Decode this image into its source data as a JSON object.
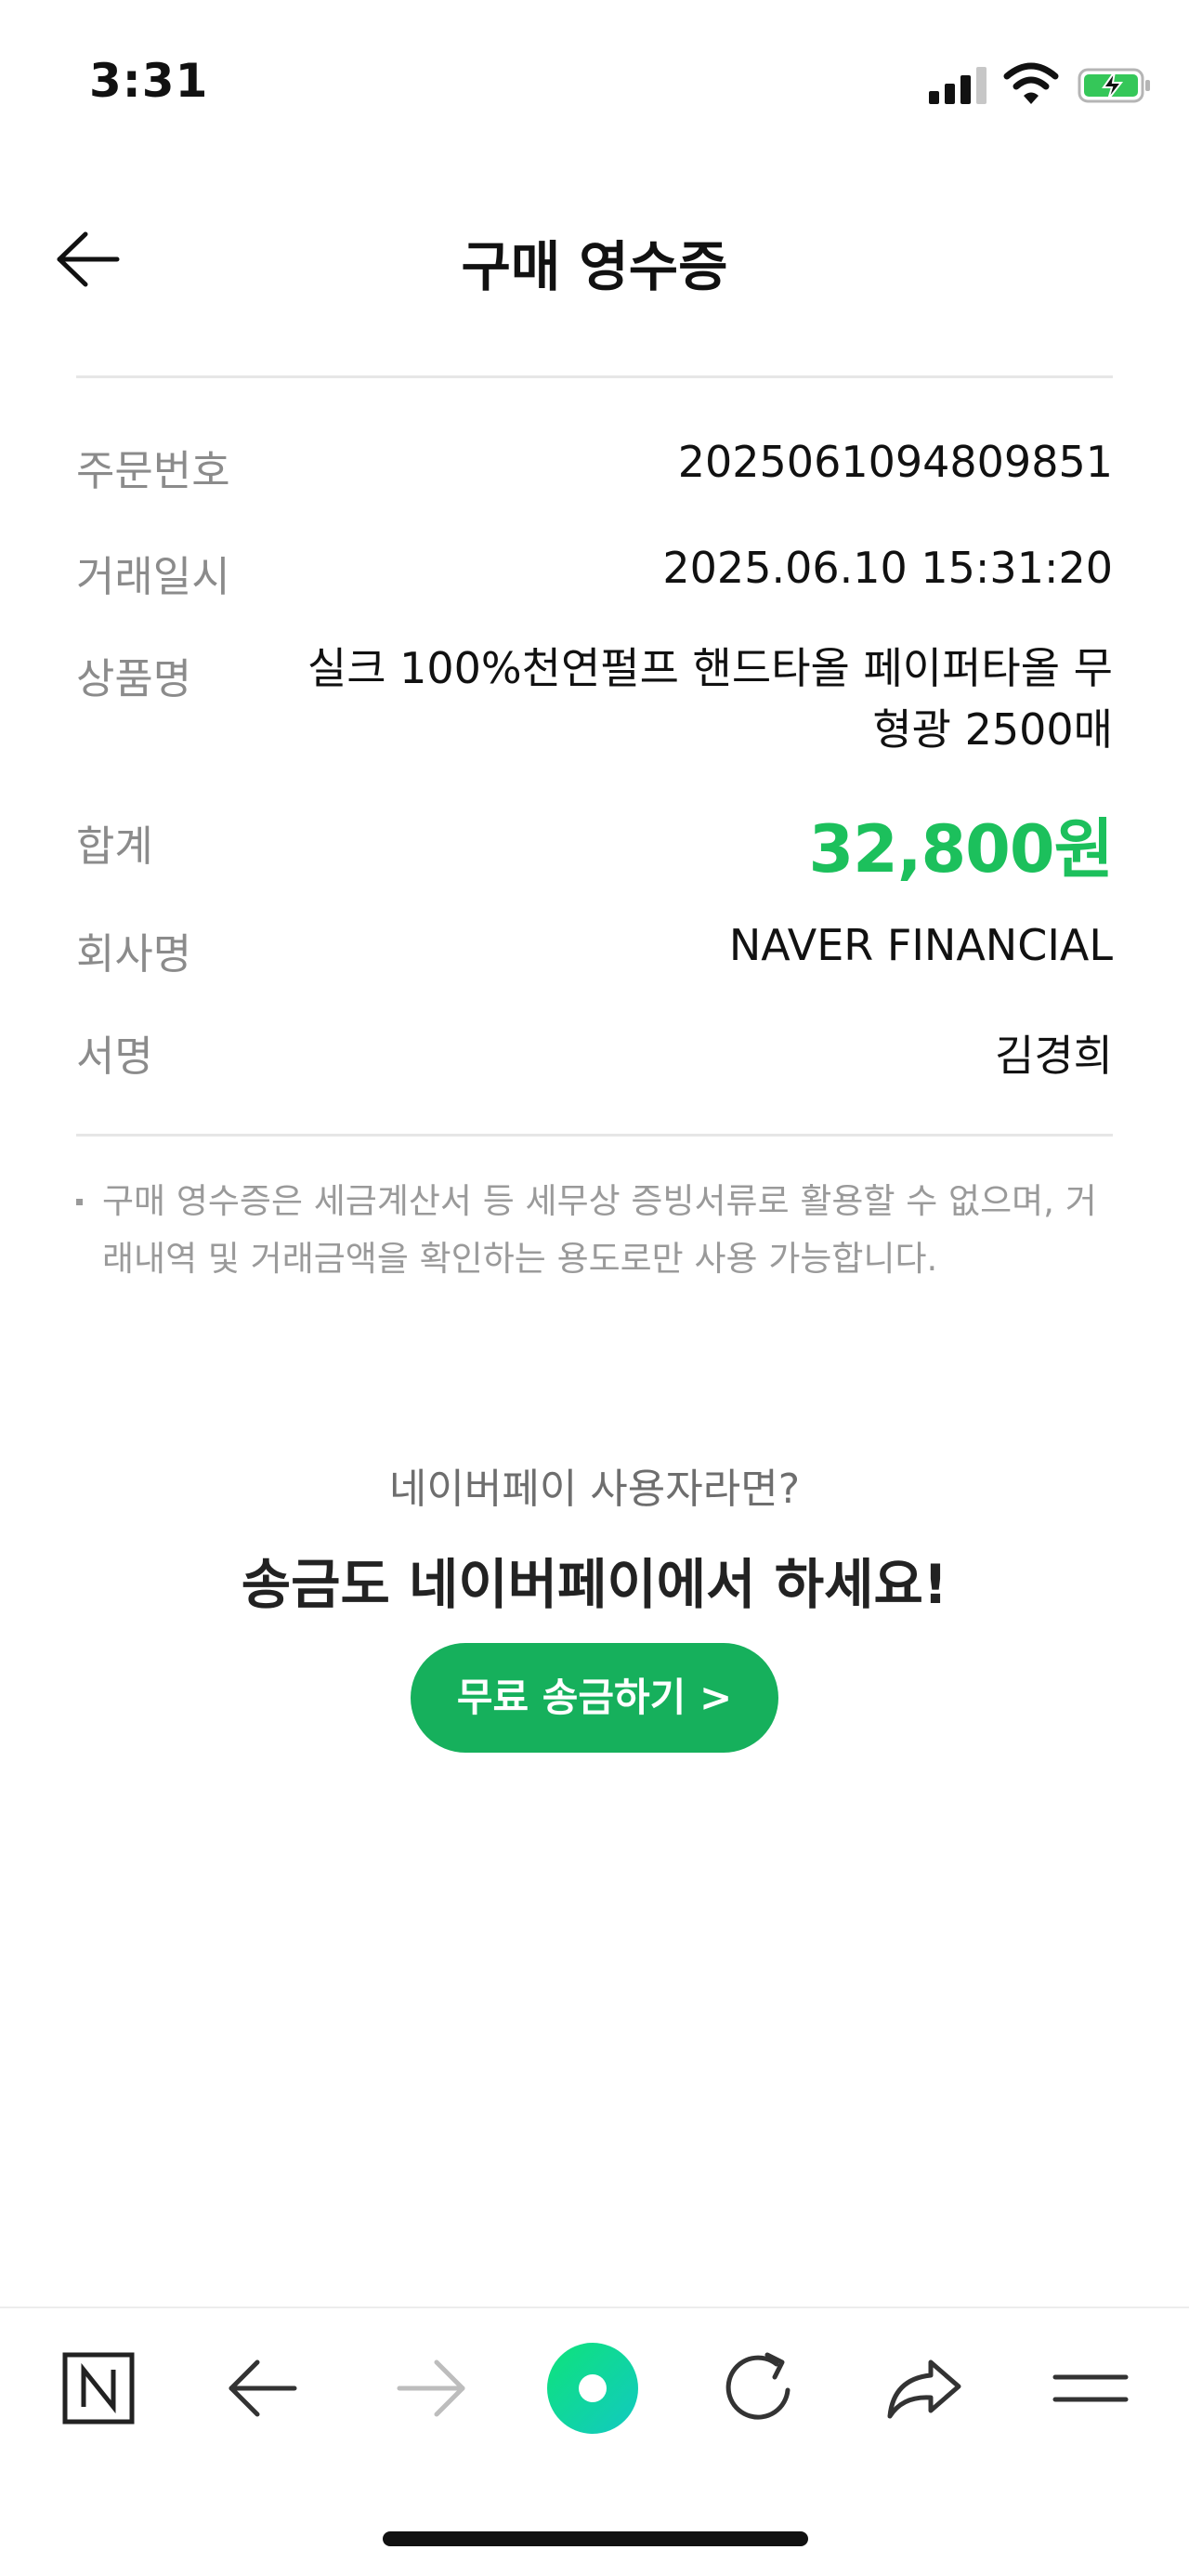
{
  "status_bar": {
    "time": "3:31"
  },
  "header": {
    "title": "구매 영수증"
  },
  "receipt": {
    "rows": [
      {
        "label": "주문번호",
        "value": "2025061094809851"
      },
      {
        "label": "거래일시",
        "value": "2025.06.10 15:31:20"
      },
      {
        "label": "상품명",
        "value": "실크 100%천연펄프 핸드타올 페이퍼타올 무형광 2500매"
      },
      {
        "label": "합계",
        "value": "32,800원"
      },
      {
        "label": "회사명",
        "value": "NAVER FINANCIAL"
      },
      {
        "label": "서명",
        "value": "김경희"
      }
    ],
    "notice": "구매 영수증은 세금계산서 등 세무상 증빙서류로 활용할 수 없으며, 거래내역 및 거래금액을 확인하는 용도로만 사용 가능합니다."
  },
  "promo": {
    "subtitle": "네이버페이 사용자라면?",
    "headline": "송금도 네이버페이에서 하세요!",
    "button_label": "무료 송금하기 >"
  },
  "colors": {
    "total_amount": "#1cc05c",
    "promo_button": "#16b05c",
    "browser_logo": "#12d6a0"
  },
  "toolbar_icons": [
    "naver-n-icon",
    "back-arrow-icon",
    "forward-arrow-icon",
    "green-dot-icon",
    "refresh-icon",
    "share-icon",
    "menu-icon"
  ]
}
